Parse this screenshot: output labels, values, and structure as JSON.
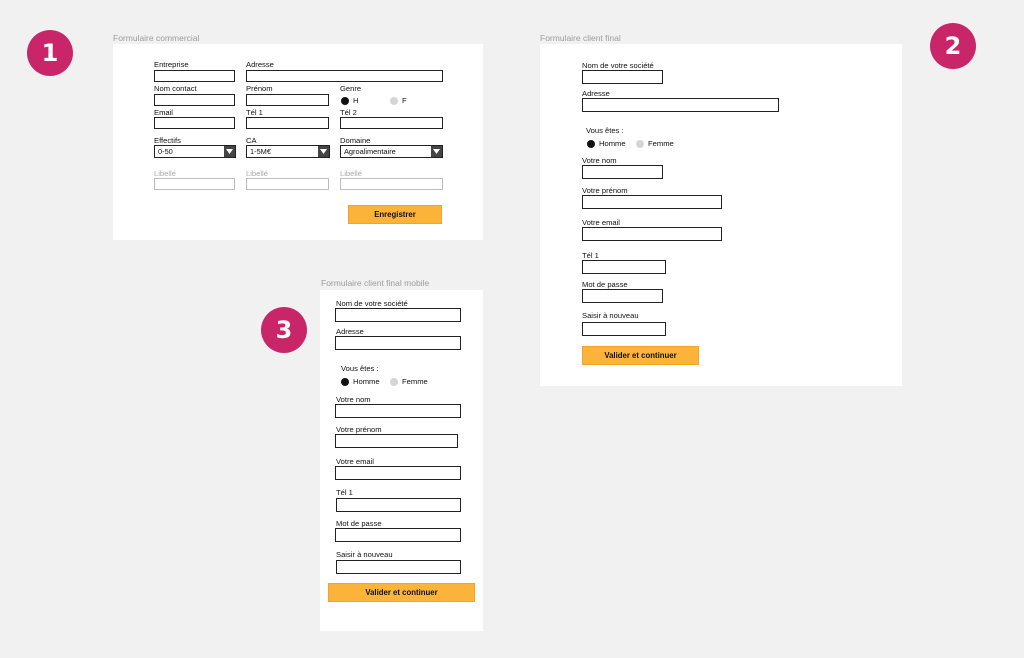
{
  "badges": [
    "1",
    "2",
    "3"
  ],
  "commercial": {
    "caption": "Formulaire commercial",
    "entreprise": "Entreprise",
    "adresse": "Adresse",
    "nom_contact": "Nom contact",
    "prenom": "Prénom",
    "genre": "Genre",
    "genre_h": "H",
    "genre_f": "F",
    "email": "Email",
    "tel1": "Tél 1",
    "tel2": "Tél 2",
    "effectifs": "Effectifs",
    "effectifs_value": "0-50",
    "ca": "CA",
    "ca_value": "1-5M€",
    "domaine": "Domaine",
    "domaine_value": "Agroalimentaire",
    "libelle": "Libellé",
    "button": "Enregistrer"
  },
  "client": {
    "caption": "Formulaire client final",
    "societe": "Nom de votre société",
    "adresse": "Adresse",
    "vous_etes": "Vous êtes :",
    "homme": "Homme",
    "femme": "Femme",
    "nom": "Votre nom",
    "prenom": "Votre prénom",
    "email": "Votre email",
    "tel1": "Tél 1",
    "mdp": "Mot de passe",
    "saisir": "Saisir à nouveau",
    "button": "Valider et continuer"
  },
  "mobile": {
    "caption": "Formulaire client final mobile",
    "societe": "Nom de votre société",
    "adresse": "Adresse",
    "vous_etes": "Vous êtes :",
    "homme": "Homme",
    "femme": "Femme",
    "nom": "Votre nom",
    "prenom": "Votre prénom",
    "email": "Votre email",
    "tel1": "Tél 1",
    "mdp": "Mot de passe",
    "saisir": "Saisir à nouveau",
    "button": "Valider et continuer"
  },
  "colors": {
    "badge": "#c9266a",
    "button": "#fbb339",
    "background": "#f1f1f1"
  }
}
